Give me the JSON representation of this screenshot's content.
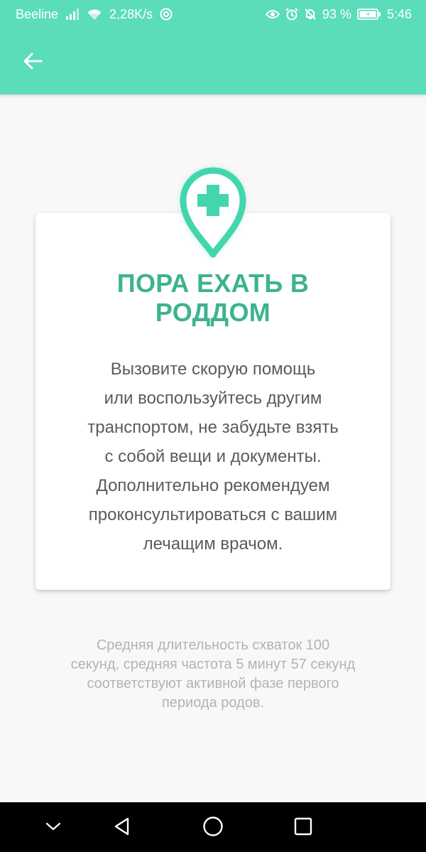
{
  "status_bar": {
    "carrier": "Beeline",
    "speed": "2,28K/s",
    "battery_percent": "93 %",
    "time": "5:46",
    "icons": [
      "signal-icon",
      "wifi-icon",
      "at-icon",
      "eye-icon",
      "alarm-icon",
      "mute-icon",
      "battery-icon"
    ]
  },
  "app_bar": {
    "back_icon": "arrow-back-icon",
    "background_color": "#5bdcbb"
  },
  "card": {
    "icon": "hospital-pin-icon",
    "title_lines": [
      "ПОРА ЕХАТЬ В",
      "РОДДОМ"
    ],
    "body_lines": [
      "Вызовите скорую помощь",
      "или воспользуйтесь другим",
      "транспортом, не забудьте взять",
      "с собой вещи и документы.",
      "Дополнительно рекомендуем",
      "проконсультироваться с вашим",
      "лечащим врачом."
    ],
    "accent_color": "#3db38f"
  },
  "footer_note_lines": [
    "Средняя длительность схваток 100",
    "секунд, средняя частота 5 минут 57 секунд",
    "соответствуют активной фазе первого",
    "периода родов."
  ],
  "nav_bar": {
    "icons": [
      "collapse-chevron-icon",
      "back-triangle-icon",
      "home-circle-icon",
      "recents-square-icon"
    ]
  }
}
